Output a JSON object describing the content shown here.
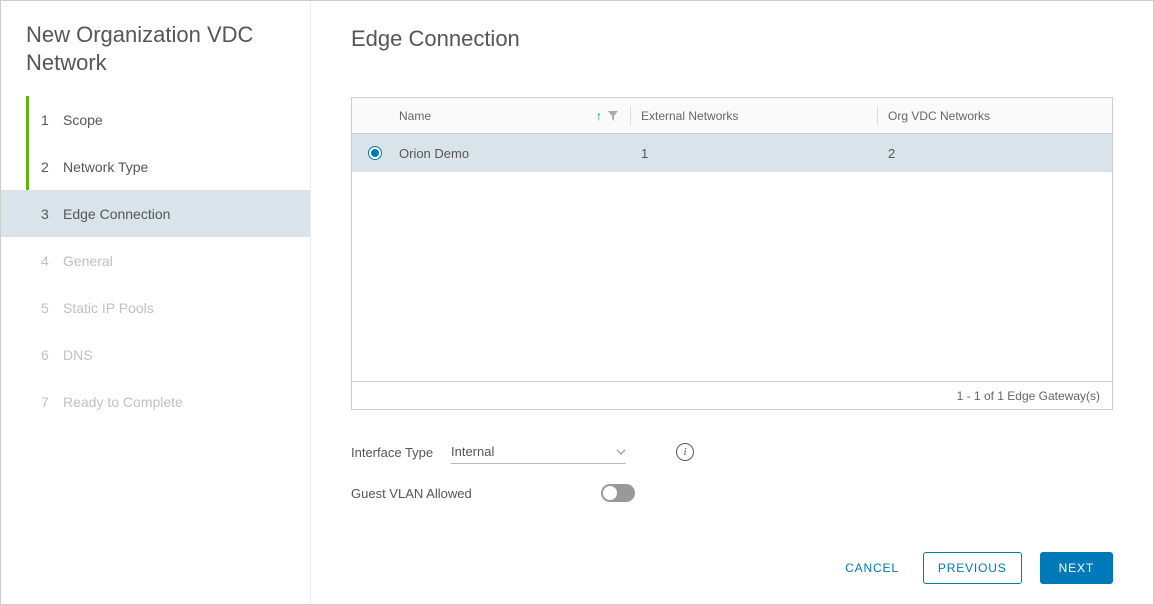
{
  "sidebar": {
    "title": "New Organization VDC Network",
    "steps": [
      {
        "num": "1",
        "label": "Scope",
        "state": "completed"
      },
      {
        "num": "2",
        "label": "Network Type",
        "state": "completed"
      },
      {
        "num": "3",
        "label": "Edge Connection",
        "state": "current"
      },
      {
        "num": "4",
        "label": "General",
        "state": "disabled"
      },
      {
        "num": "5",
        "label": "Static IP Pools",
        "state": "disabled"
      },
      {
        "num": "6",
        "label": "DNS",
        "state": "disabled"
      },
      {
        "num": "7",
        "label": "Ready to Complete",
        "state": "disabled"
      }
    ]
  },
  "main": {
    "title": "Edge Connection",
    "table": {
      "columns": {
        "name": "Name",
        "external_networks": "External Networks",
        "org_vdc_networks": "Org VDC Networks"
      },
      "rows": [
        {
          "selected": true,
          "name": "Orion Demo",
          "external_networks": "1",
          "org_vdc_networks": "2"
        }
      ],
      "footer": "1 - 1 of 1 Edge Gateway(s)"
    },
    "form": {
      "interface_type_label": "Interface Type",
      "interface_type_value": "Internal",
      "guest_vlan_label": "Guest VLAN Allowed",
      "guest_vlan_on": false
    }
  },
  "footer": {
    "cancel": "CANCEL",
    "previous": "PREVIOUS",
    "next": "NEXT"
  }
}
